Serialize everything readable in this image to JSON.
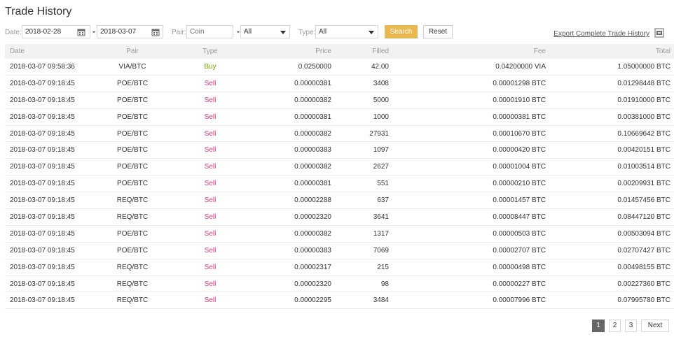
{
  "page": {
    "title": "Trade History"
  },
  "filters": {
    "date_label": "Date:",
    "date_from": "2018-02-28",
    "date_sep": "-",
    "date_to": "2018-03-07",
    "pair_label": "Pair:",
    "coin_placeholder": "Coin",
    "pair_sep": "-",
    "pair_quote": "All",
    "type_label": "Type:",
    "type_value": "All",
    "search_label": "Search",
    "reset_label": "Reset",
    "export_label": "Export Complete Trade History"
  },
  "table": {
    "headers": [
      "Date",
      "Pair",
      "Type",
      "Price",
      "Filled",
      "Fee",
      "Total"
    ],
    "rows": [
      [
        "2018-03-07 09:58:36",
        "VIA/BTC",
        "Buy",
        "0.0250000",
        "42.00",
        "0.04200000 VIA",
        "1.05000000 BTC"
      ],
      [
        "2018-03-07 09:18:45",
        "POE/BTC",
        "Sell",
        "0.00000381",
        "3408",
        "0.00001298 BTC",
        "0.01298448 BTC"
      ],
      [
        "2018-03-07 09:18:45",
        "POE/BTC",
        "Sell",
        "0.00000382",
        "5000",
        "0.00001910 BTC",
        "0.01910000 BTC"
      ],
      [
        "2018-03-07 09:18:45",
        "POE/BTC",
        "Sell",
        "0.00000381",
        "1000",
        "0.00000381 BTC",
        "0.00381000 BTC"
      ],
      [
        "2018-03-07 09:18:45",
        "POE/BTC",
        "Sell",
        "0.00000382",
        "27931",
        "0.00010670 BTC",
        "0.10669642 BTC"
      ],
      [
        "2018-03-07 09:18:45",
        "POE/BTC",
        "Sell",
        "0.00000383",
        "1097",
        "0.00000420 BTC",
        "0.00420151 BTC"
      ],
      [
        "2018-03-07 09:18:45",
        "POE/BTC",
        "Sell",
        "0.00000382",
        "2627",
        "0.00001004 BTC",
        "0.01003514 BTC"
      ],
      [
        "2018-03-07 09:18:45",
        "POE/BTC",
        "Sell",
        "0.00000381",
        "551",
        "0.00000210 BTC",
        "0.00209931 BTC"
      ],
      [
        "2018-03-07 09:18:45",
        "REQ/BTC",
        "Sell",
        "0.00002288",
        "637",
        "0.00001457 BTC",
        "0.01457456 BTC"
      ],
      [
        "2018-03-07 09:18:45",
        "REQ/BTC",
        "Sell",
        "0.00002320",
        "3641",
        "0.00008447 BTC",
        "0.08447120 BTC"
      ],
      [
        "2018-03-07 09:18:45",
        "POE/BTC",
        "Sell",
        "0.00000382",
        "1317",
        "0.00000503 BTC",
        "0.00503094 BTC"
      ],
      [
        "2018-03-07 09:18:45",
        "POE/BTC",
        "Sell",
        "0.00000383",
        "7069",
        "0.00002707 BTC",
        "0.02707427 BTC"
      ],
      [
        "2018-03-07 09:18:45",
        "REQ/BTC",
        "Sell",
        "0.00002317",
        "215",
        "0.00000498 BTC",
        "0.00498155 BTC"
      ],
      [
        "2018-03-07 09:18:45",
        "REQ/BTC",
        "Sell",
        "0.00002320",
        "98",
        "0.00000227 BTC",
        "0.00227360 BTC"
      ],
      [
        "2018-03-07 09:18:45",
        "REQ/BTC",
        "Sell",
        "0.00002295",
        "3484",
        "0.00007996 BTC",
        "0.07995780 BTC"
      ]
    ]
  },
  "pagination": {
    "pages": [
      "1",
      "2",
      "3"
    ],
    "active": "1",
    "next_label": "Next"
  },
  "colors": {
    "accent": "#e9b94f",
    "buy": "#70a800",
    "sell": "#e0327a",
    "active_page": "#666666"
  },
  "icons": {
    "date": "calendar-icon",
    "export": "export-icon",
    "dropdown": "chevron-down-icon"
  }
}
